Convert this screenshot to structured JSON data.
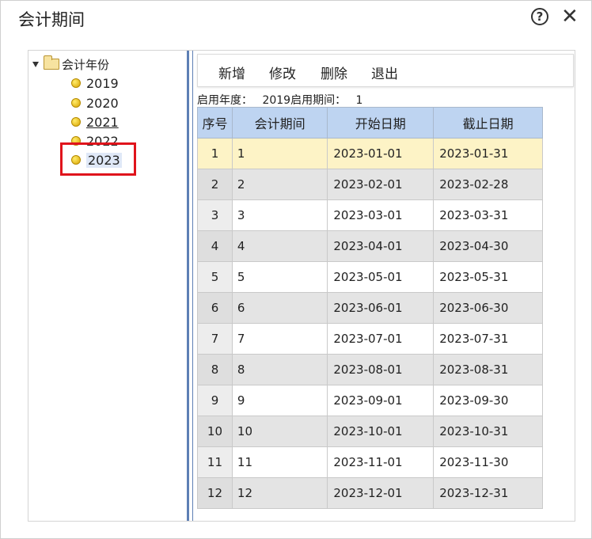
{
  "window": {
    "title": "会计期间",
    "help_icon": "help-circle-icon",
    "close_icon": "close-icon",
    "help_glyph": "?",
    "close_glyph": "✕"
  },
  "tree": {
    "root_label": "会计年份",
    "items": [
      {
        "label": "2019"
      },
      {
        "label": "2020"
      },
      {
        "label": "2021"
      },
      {
        "label": "2022"
      },
      {
        "label": "2023"
      }
    ],
    "selected": "2023"
  },
  "toolbar": {
    "add_label": "新增",
    "edit_label": "修改",
    "delete_label": "删除",
    "exit_label": "退出"
  },
  "info": {
    "start_year_label": "启用年度：",
    "start_year": "2019",
    "start_period_label": "启用期间：",
    "start_period": "1"
  },
  "grid": {
    "columns": [
      "序号",
      "会计期间",
      "开始日期",
      "截止日期"
    ],
    "rows": [
      [
        "1",
        "1",
        "2023-01-01",
        "2023-01-31"
      ],
      [
        "2",
        "2",
        "2023-02-01",
        "2023-02-28"
      ],
      [
        "3",
        "3",
        "2023-03-01",
        "2023-03-31"
      ],
      [
        "4",
        "4",
        "2023-04-01",
        "2023-04-30"
      ],
      [
        "5",
        "5",
        "2023-05-01",
        "2023-05-31"
      ],
      [
        "6",
        "6",
        "2023-06-01",
        "2023-06-30"
      ],
      [
        "7",
        "7",
        "2023-07-01",
        "2023-07-31"
      ],
      [
        "8",
        "8",
        "2023-08-01",
        "2023-08-31"
      ],
      [
        "9",
        "9",
        "2023-09-01",
        "2023-09-30"
      ],
      [
        "10",
        "10",
        "2023-10-01",
        "2023-10-31"
      ],
      [
        "11",
        "11",
        "2023-11-01",
        "2023-11-30"
      ],
      [
        "12",
        "12",
        "2023-12-01",
        "2023-12-31"
      ]
    ],
    "active_row": "1"
  },
  "colors": {
    "header_bg": "#bed4f1",
    "active_row_bg": "#fdf3c6",
    "highlight_border": "#e0141c",
    "splitter": "#5d7fb5"
  }
}
